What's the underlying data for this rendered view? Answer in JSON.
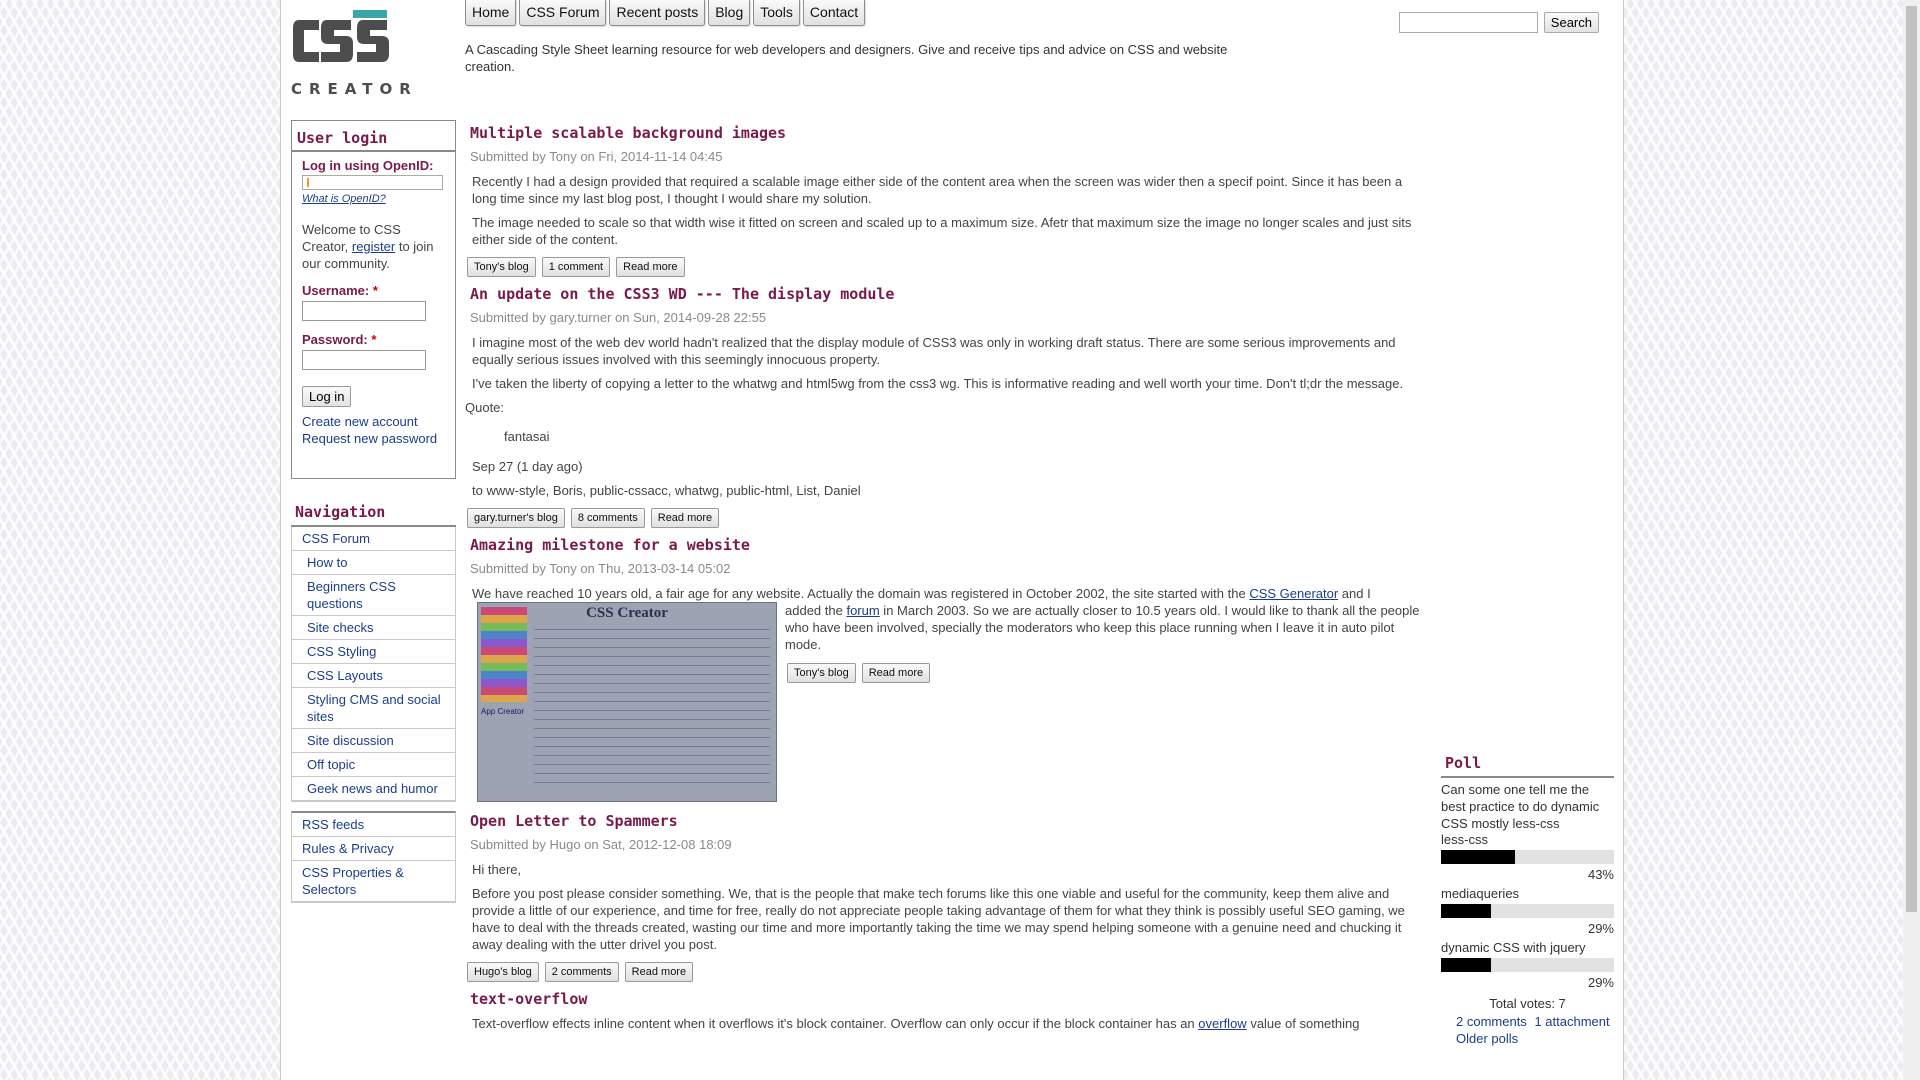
{
  "logo": {
    "word": "CREATOR",
    "alt": "CSS Creator logo"
  },
  "topnav": [
    "Home",
    "CSS Forum",
    "Recent posts",
    "Blog",
    "Tools",
    "Contact"
  ],
  "tagline": "A Cascading Style Sheet learning resource for web developers and designers. Give and receive tips and advice on CSS and website creation.",
  "search": {
    "value": "",
    "button": "Search"
  },
  "login": {
    "title": "User login",
    "openid_label": "Log in using OpenID:",
    "openid_value": "",
    "what_openid": "What is OpenID?",
    "welcome_pre": "Welcome to CSS Creator, ",
    "register": "register",
    "welcome_post": " to join our community.",
    "username_label": "Username:",
    "password_label": "Password:",
    "required_mark": "*",
    "username_value": "",
    "password_value": "",
    "button": "Log in",
    "create": "Create new account",
    "request": "Request new password"
  },
  "navigation": {
    "title": "Navigation",
    "items": [
      {
        "label": "CSS Forum",
        "sub": false
      },
      {
        "label": "How to",
        "sub": true
      },
      {
        "label": "Beginners CSS questions",
        "sub": true
      },
      {
        "label": "Site checks",
        "sub": true
      },
      {
        "label": "CSS Styling",
        "sub": true
      },
      {
        "label": "CSS Layouts",
        "sub": true
      },
      {
        "label": "Styling CMS and social sites",
        "sub": true
      },
      {
        "label": "Site discussion",
        "sub": true
      },
      {
        "label": "Off topic",
        "sub": true
      },
      {
        "label": "Geek news and humor",
        "sub": true
      }
    ]
  },
  "extra_links": [
    "RSS feeds",
    "Rules & Privacy",
    "CSS Properties & Selectors"
  ],
  "posts": [
    {
      "title": "Multiple scalable background images",
      "submitted": "Submitted by Tony on Fri, 2014-11-14 04:45",
      "paragraphs": [
        "Recently I had a design provided that required a scalable image either side of the content area when the screen was wider then a specif point. Since it has been a long time since my last blog post, I thought I would share my solution.",
        "The image needed to scale so that width wise it fitted on screen and scaled up to a maximum size. Afetr that maximum size the image no longer scales and just sits either side of the content."
      ],
      "links": [
        "Tony's blog",
        "1 comment",
        "Read more"
      ]
    },
    {
      "title": "An update on the CSS3 WD --- The display module",
      "submitted": "Submitted by gary.turner on Sun, 2014-09-28 22:55",
      "paragraphs": [
        "I imagine most of the web dev world hadn't realized that the display module of CSS3 was only in working draft status. There are some serious improvements and equally serious issues involved with this seemingly innocuous property.",
        "I've taken the liberty of copying a letter to the whatwg and html5wg from the css3 wg. This is informative reading and well worth your time. Don't tl;dr the message."
      ],
      "quote_label": "Quote:",
      "quote": "fantasai",
      "after_quote": [
        "Sep 27 (1 day ago)",
        "to www-style, Boris, public-cssacc, whatwg, public-html, List, Daniel"
      ],
      "links": [
        "gary.turner's blog",
        "8 comments",
        "Read more"
      ]
    },
    {
      "title": "Amazing milestone for a website",
      "submitted": "Submitted by Tony on Thu, 2013-03-14 05:02",
      "p1_pre": "We have reached 10 years old, a fair age for any website. Actually the domain was registered in October 2002, the site started with the ",
      "p1_link": "CSS Generator",
      "p1_post": " and I",
      "p2_pre": "added the ",
      "p2_link": "forum",
      "p2_post": " in March 2003. So we are actually closer to 10.5 years old. I would like to thank all the people who have been involved, specially the moderators who keep this place running when I leave it in auto pilot mode.",
      "shot_title": "CSS Creator",
      "shot_label": "App Creator",
      "links": [
        "Tony's blog",
        "Read more"
      ]
    },
    {
      "title": "Open Letter to Spammers",
      "submitted": "Submitted by Hugo on Sat, 2012-12-08 18:09",
      "paragraphs": [
        "Hi there,",
        "Before you post please consider something. We, that is the people that make tech forums like this one viable and useful for the community, keep them alive and provide a little of our experience, and time for free, really do not appreciate people taking advantage of them for what they think is possibly useful SEO gaming, we have to deal with the threads created, wasting our time and more importantly taking the time we may spend helping someone with a genuine need and chucking it away dealing with the utter drivel you post."
      ],
      "links": [
        "Hugo's blog",
        "2 comments",
        "Read more"
      ]
    },
    {
      "title": "text-overflow",
      "p_pre": "Text-overflow effects inline content when it overflows it's block container. Overflow can only occur if the block container has an ",
      "p_link": "overflow",
      "p_post": " value of something"
    }
  ],
  "poll": {
    "title": "Poll",
    "question": "Can some one tell me the best practice to do dynamic CSS mostly less-css",
    "choices": [
      {
        "label": "less-css",
        "percent": 43,
        "pct_text": "43%"
      },
      {
        "label": "mediaqueries",
        "percent": 29,
        "pct_text": "29%"
      },
      {
        "label": "dynamic CSS with jquery",
        "percent": 29,
        "pct_text": "29%"
      }
    ],
    "total": "Total votes: 7",
    "links": [
      "2 comments",
      "1 attachment",
      "Older polls"
    ]
  }
}
